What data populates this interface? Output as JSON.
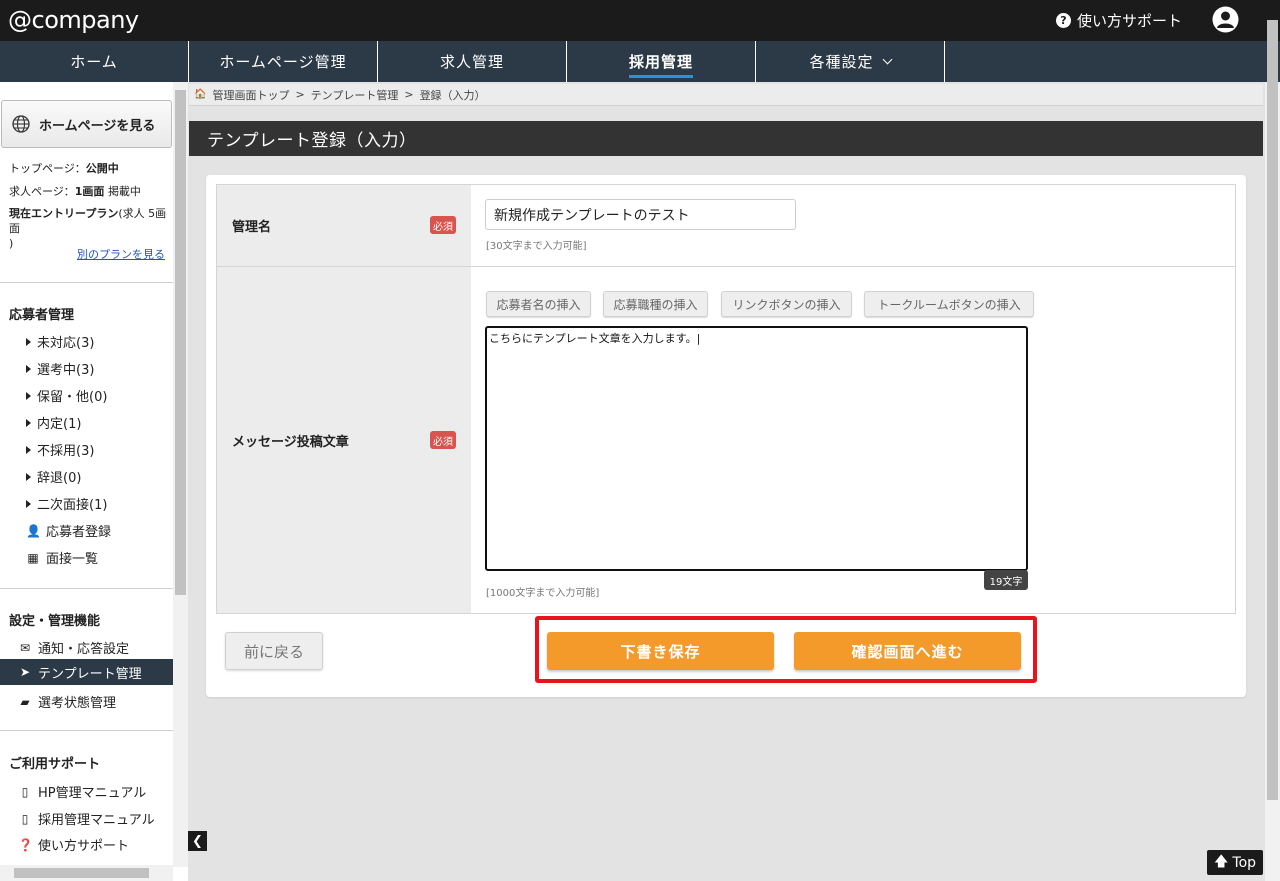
{
  "header": {
    "logo": "@company",
    "support_label": "使い方サポート"
  },
  "nav": {
    "items": [
      {
        "label": "ホーム"
      },
      {
        "label": "ホームページ管理"
      },
      {
        "label": "求人管理"
      },
      {
        "label": "採用管理"
      },
      {
        "label": "各種設定"
      }
    ],
    "active_index": 3
  },
  "sidebar": {
    "view_hp_button": "ホームページを見る",
    "top_page_label": "トップページ：",
    "top_page_value": "公開中",
    "job_page_label": "求人ページ：",
    "job_page_value": "1画面",
    "job_page_suffix": "掲載中",
    "plan_label": "現在エントリープラン",
    "plan_value": "(求人 5画面",
    "plan_close": ")",
    "other_plan_link": "別のプランを見る",
    "applicant_heading": "応募者管理",
    "applicant_items": [
      "未対応(3)",
      "選考中(3)",
      "保留・他(0)",
      "内定(1)",
      "不採用(3)",
      "辞退(0)",
      "二次面接(1)"
    ],
    "register_applicant": "応募者登録",
    "interview_list": "面接一覧",
    "settings_heading": "設定・管理機能",
    "notify_settings": "通知・応答設定",
    "template_mgmt": "テンプレート管理",
    "status_mgmt": "選考状態管理",
    "support_heading": "ご利用サポート",
    "hp_manual": "HP管理マニュアル",
    "recruit_manual": "採用管理マニュアル",
    "usage_support": "使い方サポート"
  },
  "breadcrumb": {
    "items": [
      "管理画面トップ",
      "テンプレート管理",
      "登録（入力）"
    ],
    "separator": ">"
  },
  "page_title": "テンプレート登録（入力）",
  "form": {
    "name_label": "管理名",
    "required_badge": "必須",
    "name_value": "新規作成テンプレートのテスト",
    "name_hint": "[30文字まで入力可能]",
    "message_label": "メッセージ投稿文章",
    "insert_buttons": [
      "応募者名の挿入",
      "応募職種の挿入",
      "リンクボタンの挿入",
      "トークルームボタンの挿入"
    ],
    "message_value": "こちらにテンプレート文章を入力します。|",
    "char_count": "19文字",
    "message_hint": "[1000文字まで入力可能]"
  },
  "actions": {
    "back": "前に戻る",
    "save_draft": "下書き保存",
    "proceed_confirm": "確認画面へ進む"
  },
  "page_top_button": "Top",
  "colors": {
    "topbar": "#1b1b1b",
    "nav": "#2c3a47",
    "accent_underline": "#2f8ee0",
    "required": "#d9534f",
    "primary_button": "#f39a2b",
    "highlight": "#e8131b"
  }
}
